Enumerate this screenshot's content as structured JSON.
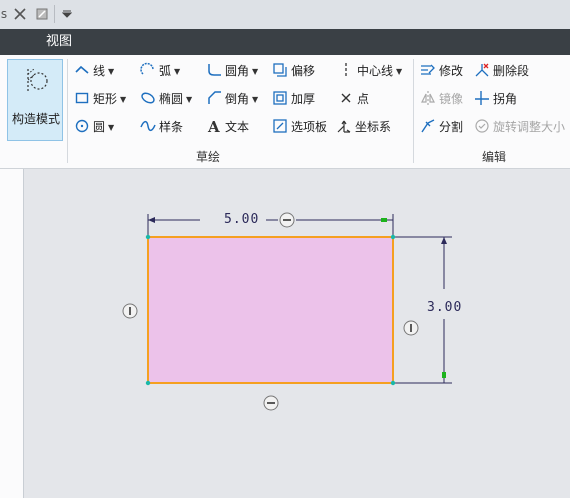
{
  "quick_access": {
    "icons": [
      "close-window-icon",
      "window-icon",
      "customize-dropdown-icon"
    ]
  },
  "tabs": {
    "active": "视图"
  },
  "ribbon": {
    "sketch_group": {
      "label": "草绘",
      "construction_mode": "构造模式",
      "line": "线",
      "arc": "弧",
      "fillet": "圆角",
      "offset": "偏移",
      "centerline": "中心线",
      "rectangle": "矩形",
      "ellipse": "椭圆",
      "chamfer": "倒角",
      "thicken": "加厚",
      "point": "点",
      "circle": "圆",
      "spline": "样条",
      "text": "文本",
      "palette": "选项板",
      "coordinate_system": "坐标系"
    },
    "edit_group": {
      "label": "编辑",
      "modify": "修改",
      "delete_segment": "删除段",
      "mirror": "镜像",
      "corner": "拐角",
      "divide": "分割",
      "rotate_resize": "旋转调整大小"
    }
  },
  "sketch": {
    "rectangle_fill": "#ecc2ea",
    "rectangle_stroke": "#f5a020",
    "dimension_color": "#2c2a5a",
    "width_dimension": "5.00",
    "height_dimension": "3.00"
  }
}
